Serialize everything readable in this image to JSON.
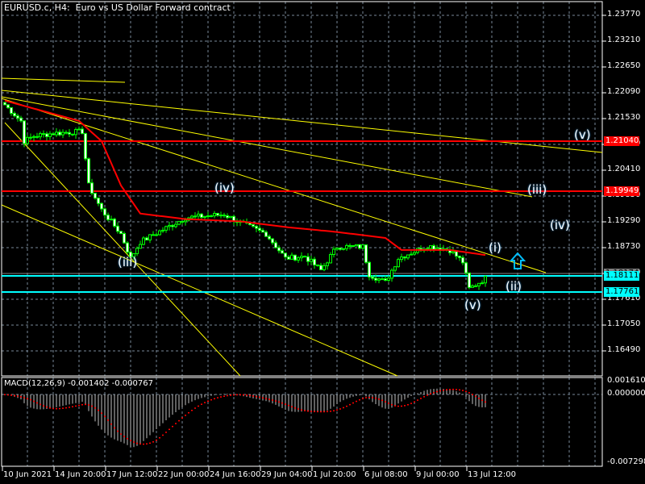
{
  "header": {
    "title": "EURUSD.c, H4:  Euro vs US Dollar Forward contract"
  },
  "chart_data": {
    "type": "candlestick",
    "title": "EURUSD.c, H4:  Euro vs US Dollar Forward contract",
    "ylim": [
      1.1593,
      1.2405
    ],
    "grid": true,
    "price_ticks": [
      "1.23770",
      "1.23210",
      "1.22650",
      "1.22090",
      "1.21530",
      "1.20970",
      "1.20410",
      "1.19850",
      "1.19290",
      "1.18730",
      "1.18170",
      "1.17610",
      "1.17050",
      "1.16490"
    ],
    "time_ticks": [
      "10 Jun 2021",
      "14 Jun 20:00",
      "17 Jun 12:00",
      "22 Jun 00:00",
      "24 Jun 16:00",
      "29 Jun 04:00",
      "1 Jul 20:00",
      "6 Jul 08:00",
      "9 Jul 00:00",
      "13 Jul 12:00"
    ],
    "close_path": [
      [
        0,
        1.2183
      ],
      [
        5,
        1.2148
      ],
      [
        6,
        1.2104
      ],
      [
        9,
        1.2115
      ],
      [
        15,
        1.2121
      ],
      [
        24,
        1.2125
      ],
      [
        26,
        1.2008
      ],
      [
        30,
        1.1955
      ],
      [
        36,
        1.1903
      ],
      [
        39,
        1.185
      ],
      [
        42,
        1.1885
      ],
      [
        49,
        1.1912
      ],
      [
        56,
        1.1938
      ],
      [
        68,
        1.1945
      ],
      [
        73,
        1.1927
      ],
      [
        81,
        1.1903
      ],
      [
        87,
        1.185
      ],
      [
        93,
        1.1854
      ],
      [
        98,
        1.1824
      ],
      [
        103,
        1.1875
      ],
      [
        111,
        1.1875
      ],
      [
        113,
        1.1815
      ],
      [
        118,
        1.1798
      ],
      [
        122,
        1.185
      ],
      [
        131,
        1.1877
      ],
      [
        138,
        1.1868
      ],
      [
        142,
        1.1842
      ],
      [
        144,
        1.1784
      ],
      [
        149,
        1.1806
      ]
    ],
    "ma_path": [
      [
        0,
        1.2192
      ],
      [
        23,
        1.2148
      ],
      [
        30,
        1.2104
      ],
      [
        36,
        1.2008
      ],
      [
        42,
        1.1947
      ],
      [
        56,
        1.1935
      ],
      [
        73,
        1.193
      ],
      [
        88,
        1.1917
      ],
      [
        103,
        1.1907
      ],
      [
        118,
        1.1894
      ],
      [
        123,
        1.1868
      ],
      [
        138,
        1.1868
      ],
      [
        149,
        1.1857
      ]
    ],
    "hlines": [
      {
        "price": 1.2104,
        "label": "1.21040",
        "color": "#ff0000"
      },
      {
        "price": 1.19949,
        "label": "1.19949",
        "color": "#ff0000"
      },
      {
        "price": 1.18174,
        "label": "1.18174",
        "color": "#808080"
      },
      {
        "price": 1.18111,
        "label": "1.18111",
        "color": "#00ffff"
      },
      {
        "price": 1.17761,
        "label": "1.17761",
        "color": "#00ffff"
      }
    ],
    "wave_labels": [
      "(v)",
      "(iii)",
      "(iv)",
      "(iv)",
      "(iii)",
      "(i)",
      "(ii)",
      "(v)"
    ],
    "macd": {
      "label": "MACD(12,26,9) -0.001402 -0.000767",
      "ticks": [
        "0.001610",
        "0.000000",
        "-0.007298"
      ],
      "ylim": [
        -0.007298,
        0.00161
      ]
    },
    "colors": {
      "bull": "#00ff00",
      "bear_body": "#ffffff",
      "ma": "#ff0000",
      "trendline": "#ffff00",
      "grid": "#778899",
      "arrow": "#00bfff"
    }
  }
}
